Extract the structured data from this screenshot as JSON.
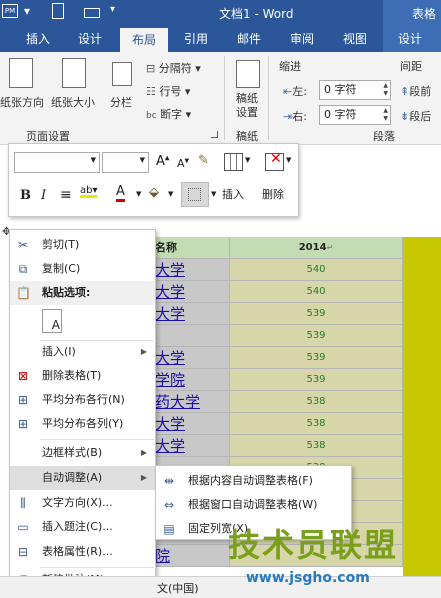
{
  "window": {
    "qat_icon": "PM",
    "title": "文档1 - Word",
    "context_group": "表格"
  },
  "tabs": [
    {
      "label": "插入"
    },
    {
      "label": "设计"
    },
    {
      "label": "布局"
    },
    {
      "label": "引用"
    },
    {
      "label": "邮件"
    },
    {
      "label": "审阅"
    },
    {
      "label": "视图"
    },
    {
      "label": "设计"
    }
  ],
  "ribbon": {
    "margins": "纸张方向",
    "size": "纸张大小",
    "columns": "分栏",
    "breaks": "分隔符",
    "line_numbers": "行号",
    "hyphenation": "断字",
    "page_setup_group": "页面设置",
    "draft": "稿纸",
    "draft_settings_line1": "稿纸",
    "draft_settings_line2": "设置",
    "draft_group": "稿纸",
    "indent_header": "缩进",
    "indent_left_label": "左:",
    "indent_left_value": "0 字符",
    "indent_right_label": "右:",
    "indent_right_value": "0 字符",
    "spacing_header": "间距",
    "spacing_before": "段前",
    "spacing_after": "段后",
    "paragraph_group": "段落"
  },
  "mini_toolbar": {
    "insert": "插入",
    "delete": "删除"
  },
  "table": {
    "header_name": "名称",
    "header_year": "2014",
    "rows": [
      {
        "name": "大学",
        "value": "540"
      },
      {
        "name": "大学",
        "value": "540"
      },
      {
        "name": "大学",
        "value": "539"
      },
      {
        "name": "",
        "value": "539"
      },
      {
        "name": "大学",
        "value": "539"
      },
      {
        "name": "学院",
        "value": "539"
      },
      {
        "name": "药大学",
        "value": "538"
      },
      {
        "name": "大学",
        "value": "538"
      },
      {
        "name": "大学",
        "value": "538"
      },
      {
        "name": "",
        "value": "538"
      },
      {
        "name": "",
        "value": ""
      },
      {
        "name": "",
        "value": ""
      },
      {
        "name": "",
        "value": ""
      },
      {
        "name": "院",
        "value": ""
      }
    ]
  },
  "context_menu": {
    "cut": "剪切(T)",
    "copy": "复制(C)",
    "paste_options": "粘贴选项:",
    "insert": "插入(I)",
    "delete_table": "删除表格(T)",
    "distribute_rows": "平均分布各行(N)",
    "distribute_cols": "平均分布各列(Y)",
    "border_styles": "边框样式(B)",
    "autofit": "自动调整(A)",
    "text_direction": "文字方向(X)...",
    "insert_caption": "插入题注(C)...",
    "table_properties": "表格属性(R)...",
    "new_comment": "新建批注(M)"
  },
  "autofit_submenu": {
    "autofit_contents": "根据内容自动调整表格(F)",
    "autofit_window": "根据窗口自动调整表格(W)",
    "fixed_width": "固定列宽(X)"
  },
  "status_bar": {
    "language": "文(中国)"
  },
  "watermark": {
    "title": "技术员联盟",
    "url": "www.jsgho.com"
  },
  "colors": {
    "word_blue": "#2b579a",
    "table_header_green": "#c4dcb4",
    "value_col": "#d6d6a8",
    "lime_col": "#c8c800",
    "row_gray": "#c8c8c8",
    "hover": "#dedede"
  }
}
